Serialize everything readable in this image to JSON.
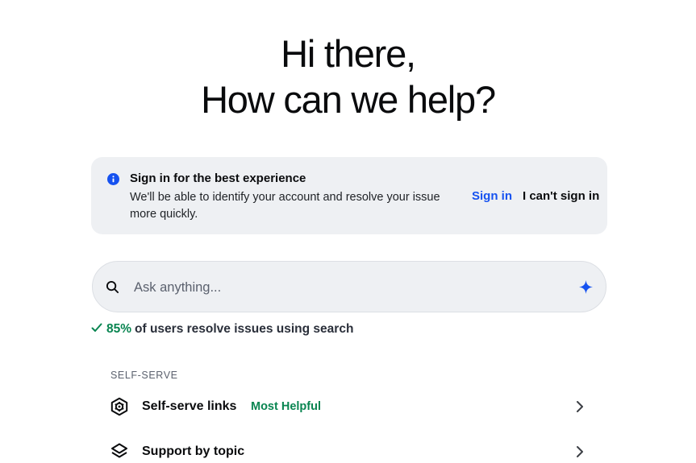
{
  "hero": {
    "line1": "Hi there,",
    "line2": "How can we help?"
  },
  "signin_banner": {
    "icon": "info-icon",
    "title": "Sign in for the best experience",
    "body": "We'll be able to identify your account and resolve your issue more quickly.",
    "signin_label": "Sign in",
    "cant_signin_label": "I can't sign in"
  },
  "search": {
    "placeholder": "Ask anything...",
    "value": "",
    "icon": "search-icon",
    "assist_icon": "sparkle-icon"
  },
  "stat": {
    "icon": "check-icon",
    "percent": "85%",
    "text": "of users resolve issues using search"
  },
  "self_serve": {
    "label": "SELF-SERVE",
    "items": [
      {
        "label": "Self-serve links",
        "badge": "Most Helpful",
        "icon": "gear-hexagon-icon"
      },
      {
        "label": "Support by topic",
        "badge": "",
        "icon": "layers-icon"
      }
    ]
  },
  "colors": {
    "accent_blue": "#1652f0",
    "success_green": "#098551",
    "surface_gray": "#eef0f3",
    "text_primary": "#0a0b0d"
  }
}
